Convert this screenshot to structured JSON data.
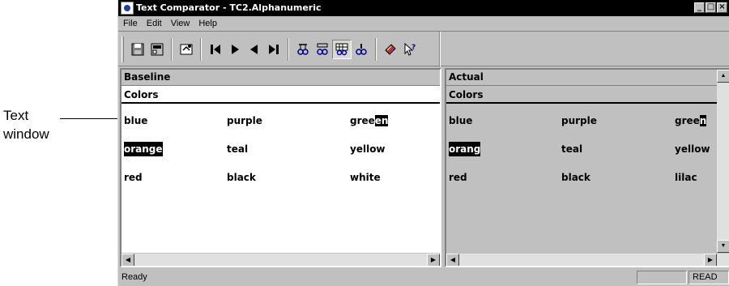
{
  "callout": {
    "line1": "Text",
    "line2": "window"
  },
  "window": {
    "title": "Text Comparator - TC2.Alphanumeric"
  },
  "window_buttons": {
    "minimize": "_",
    "maximize": "□",
    "close": "×"
  },
  "menu": {
    "items": [
      "File",
      "Edit",
      "View",
      "Help"
    ]
  },
  "toolbar": {
    "buttons": [
      "save-icon",
      "properties-icon",
      "options-icon",
      "first-diff-icon",
      "next-diff-icon",
      "previous-diff-icon",
      "last-diff-icon",
      "compare-chars-icon",
      "compare-words-icon",
      "compare-grid-icon",
      "compare-lines-icon",
      "book-icon",
      "help-pointer-icon"
    ]
  },
  "baseline": {
    "header": "Baseline",
    "sub": "Colors",
    "rows": [
      [
        "blue",
        "purple",
        "gree",
        "en"
      ],
      [
        "orange",
        "teal",
        "yellow"
      ],
      [
        "red",
        "black",
        "white"
      ]
    ]
  },
  "actual": {
    "header": "Actual",
    "sub": "Colors",
    "rows": [
      [
        "blue",
        "purple",
        "gree",
        "n"
      ],
      [
        "orang",
        "teal",
        "yellow"
      ],
      [
        "red",
        "black",
        "lilac"
      ]
    ]
  },
  "status": {
    "text": "Ready",
    "mode": "READ"
  },
  "colors": {
    "titlebar": "#000000",
    "face": "#c0c0c0",
    "highlight": "#000000"
  }
}
